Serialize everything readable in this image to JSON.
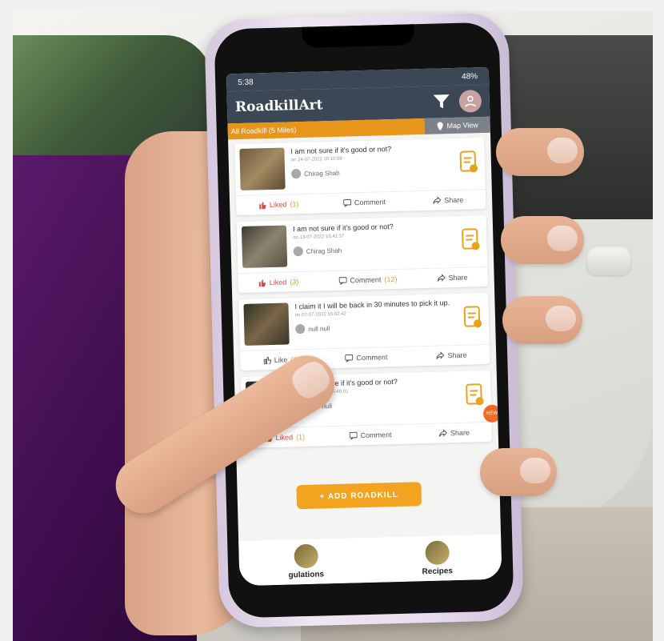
{
  "status_bar": {
    "time": "5:38",
    "right": "48%"
  },
  "app": {
    "title": "RoadkillArt"
  },
  "sub_bar": {
    "radius_label": "All Roadkill (5 Miles)",
    "map_view_label": "Map View"
  },
  "posts": [
    {
      "title": "I am not sure if it's good or not?",
      "time": "on 24-07-2022 10:10:08",
      "user": "Chirag Shah",
      "like_label": "Liked",
      "like_count": "(1)",
      "liked": true,
      "comment_label": "Comment",
      "comment_count": "",
      "share_label": "Share"
    },
    {
      "title": "I am not sure if it's good or not?",
      "time": "on 13-07-2022 16:41:37",
      "user": "Chirag Shah",
      "like_label": "Liked",
      "like_count": "(3)",
      "liked": true,
      "comment_label": "Comment",
      "comment_count": "(12)",
      "share_label": "Share"
    },
    {
      "title": "I claim it I will be back in 30 minutes to pick it up.",
      "time": "on 07-07-2022 15:02:42",
      "user": "null null",
      "like_label": "Like",
      "like_count": "(1)",
      "liked": false,
      "comment_label": "Comment",
      "comment_count": "",
      "share_label": "Share"
    },
    {
      "title": "I am not sure if it's good or not?",
      "time": "on 30-06-2022 15:49:01",
      "user": "null null",
      "like_label": "Liked",
      "like_count": "(1)",
      "liked": true,
      "comment_label": "Comment",
      "comment_count": "",
      "share_label": "Share"
    }
  ],
  "add_button": {
    "label": "+ ADD ROADKILL",
    "visible_suffix": "ADKILL"
  },
  "bottom_nav": {
    "items": [
      "gulations",
      "Recipes"
    ]
  },
  "colors": {
    "header": "#3b4755",
    "accent": "#e8961b",
    "liked": "#d94848"
  }
}
